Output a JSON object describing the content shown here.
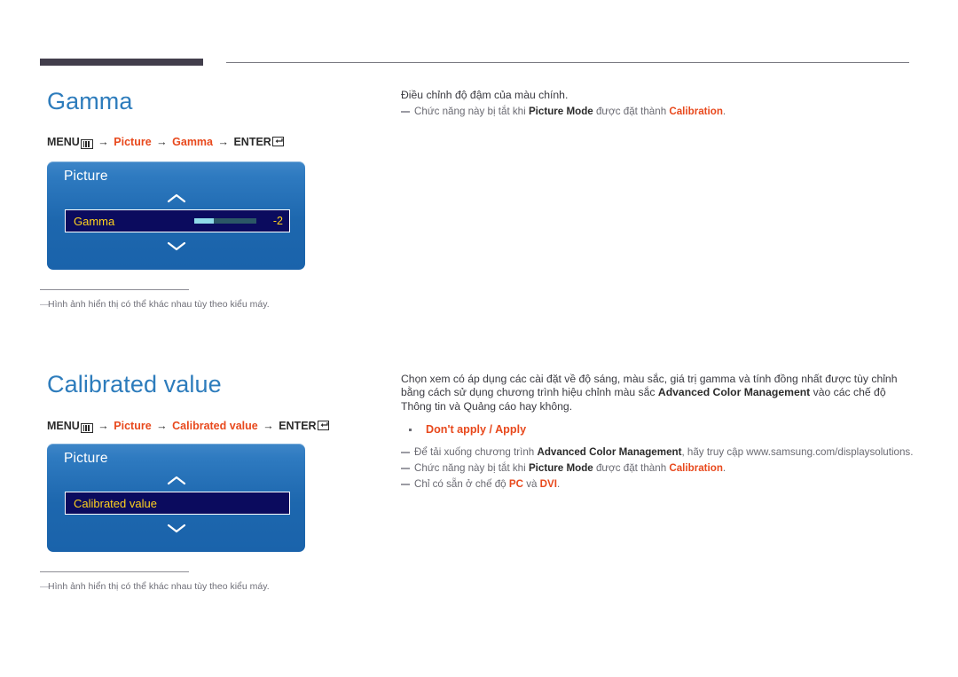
{
  "document": {
    "language": "vi",
    "accent_color": "#2d7cbc",
    "highlight_color": "#e8491d",
    "osd_blue": "#1d67ae",
    "osd_row_bg": "#0b0b5e",
    "osd_value_color": "#ffd21e"
  },
  "sections": [
    {
      "id": "gamma",
      "title": "Gamma",
      "breadcrumb": {
        "menu_label": "MENU",
        "menu_icon": "menu-grid-icon",
        "arrow": "→",
        "steps": [
          "Picture",
          "Gamma"
        ],
        "enter_label": "ENTER",
        "enter_icon": "enter-return-icon"
      },
      "osd": {
        "title": "Picture",
        "up_icon": "chevron-up-icon",
        "down_icon": "chevron-down-icon",
        "row_label": "Gamma",
        "row_value": "-2",
        "slider_fill_percent": 31,
        "has_slider": true
      },
      "footnote": {
        "dash": "―",
        "text": "Hình ảnh hiển thị có thể khác nhau tùy theo kiểu máy."
      },
      "right": {
        "description": "Điều chỉnh độ đậm của màu chính.",
        "notes": [
          {
            "parts": [
              {
                "t": "Chức năng này bị tắt khi ",
                "s": "plain"
              },
              {
                "t": "Picture Mode",
                "s": "b"
              },
              {
                "t": " được đặt thành ",
                "s": "plain"
              },
              {
                "t": "Calibration",
                "s": "o"
              },
              {
                "t": ".",
                "s": "plain"
              }
            ]
          }
        ]
      }
    },
    {
      "id": "calibrated-value",
      "title": "Calibrated value",
      "breadcrumb": {
        "menu_label": "MENU",
        "menu_icon": "menu-grid-icon",
        "arrow": "→",
        "steps": [
          "Picture",
          "Calibrated value"
        ],
        "enter_label": "ENTER",
        "enter_icon": "enter-return-icon"
      },
      "osd": {
        "title": "Picture",
        "up_icon": "chevron-up-icon",
        "down_icon": "chevron-down-icon",
        "row_label": "Calibrated value",
        "row_value": "",
        "slider_fill_percent": 0,
        "has_slider": false
      },
      "footnote": {
        "dash": "―",
        "text": "Hình ảnh hiển thị có thể khác nhau tùy theo kiểu máy."
      },
      "right": {
        "description_parts": [
          {
            "t": "Chọn xem có áp dụng các cài đặt về độ sáng, màu sắc, giá trị gamma và tính đồng nhất được tùy chỉnh bằng cách sử dụng chương trình hiệu chỉnh màu sắc ",
            "s": "plain"
          },
          {
            "t": "Advanced Color Management",
            "s": "b"
          },
          {
            "t": " vào các chế độ Thông tin và Quảng cáo hay không.",
            "s": "plain"
          }
        ],
        "bullet": "Don't apply / Apply",
        "notes": [
          {
            "parts": [
              {
                "t": "Để tải xuống chương trình ",
                "s": "plain"
              },
              {
                "t": "Advanced Color Management",
                "s": "b"
              },
              {
                "t": ", hãy truy cập www.samsung.com/displaysolutions.",
                "s": "plain"
              }
            ]
          },
          {
            "parts": [
              {
                "t": "Chức năng này bị tắt khi ",
                "s": "plain"
              },
              {
                "t": "Picture Mode",
                "s": "b"
              },
              {
                "t": " được đặt thành ",
                "s": "plain"
              },
              {
                "t": "Calibration",
                "s": "o"
              },
              {
                "t": ".",
                "s": "plain"
              }
            ]
          },
          {
            "parts": [
              {
                "t": "Chỉ có sẵn ở chế độ ",
                "s": "plain"
              },
              {
                "t": "PC",
                "s": "o"
              },
              {
                "t": " và ",
                "s": "plain"
              },
              {
                "t": "DVI",
                "s": "o"
              },
              {
                "t": ".",
                "s": "plain"
              }
            ]
          }
        ]
      }
    }
  ]
}
